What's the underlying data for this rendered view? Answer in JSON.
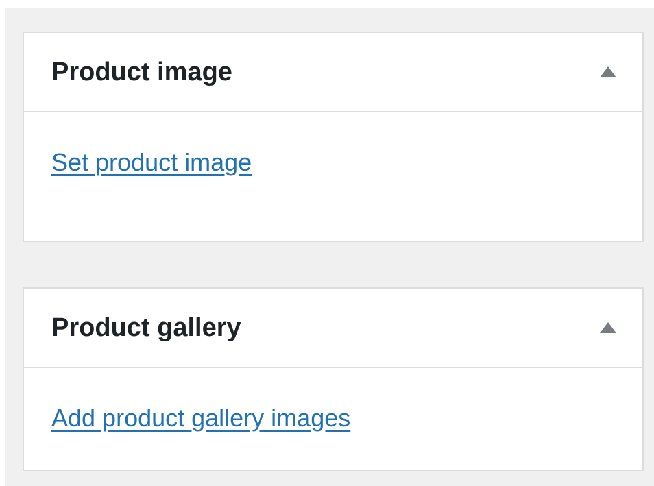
{
  "product_image": {
    "title": "Product image",
    "toggle_icon": "triangle-up-icon",
    "link_label": "Set product image"
  },
  "product_gallery": {
    "title": "Product gallery",
    "toggle_icon": "triangle-up-icon",
    "link_label": "Add product gallery images"
  },
  "colors": {
    "background": "#f0f0f1",
    "panel": "#ffffff",
    "border": "#dcdcde",
    "title": "#1d2327",
    "link": "#2271b1",
    "icon": "#787c82"
  }
}
